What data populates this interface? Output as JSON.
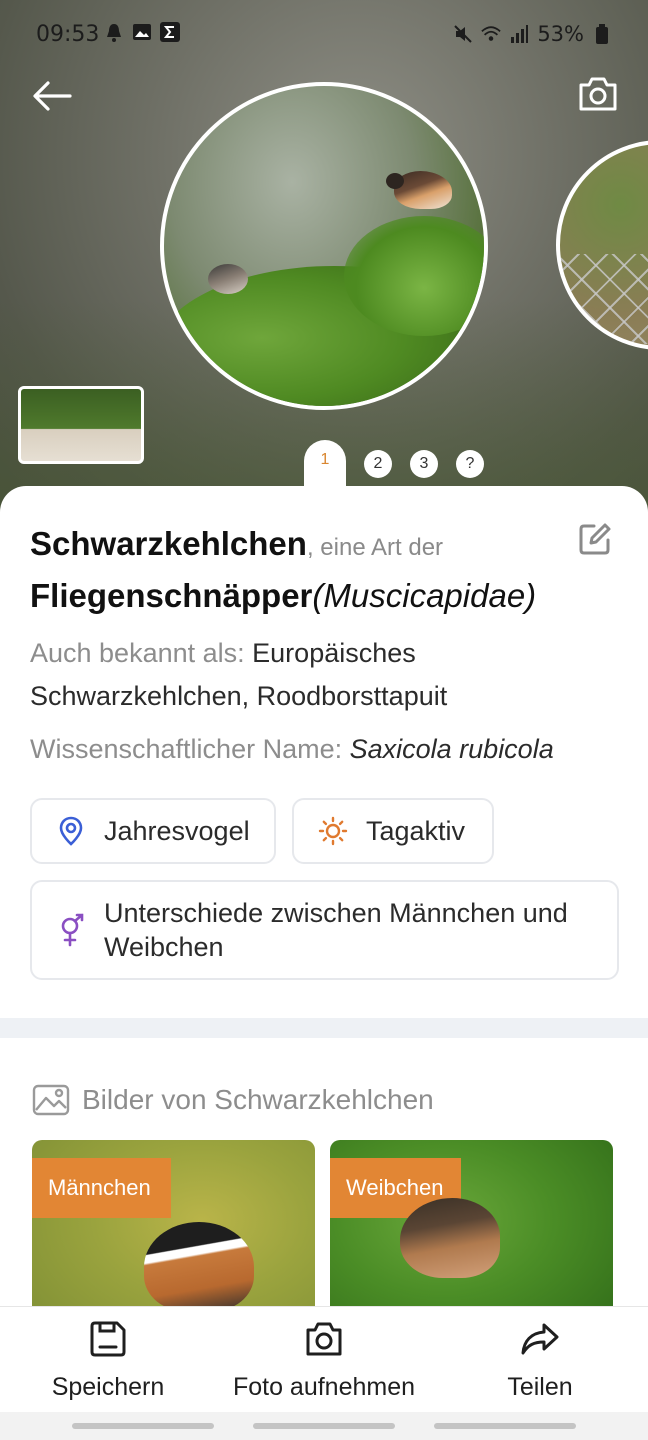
{
  "status_bar": {
    "time": "09:53",
    "battery": "53%",
    "icons": [
      "notification-icon",
      "image-icon",
      "sigma-icon",
      "mute-icon",
      "wifi-icon",
      "signal-icon",
      "battery-icon"
    ]
  },
  "hero": {
    "pages": [
      "1",
      "2",
      "3",
      "?"
    ],
    "active_page": "1"
  },
  "species": {
    "name": "Schwarzkehlchen",
    "kind_text": ", eine Art der",
    "family": "Fliegenschnäpper",
    "family_latin": "(Muscicapidae)",
    "aka_label": "Auch bekannt als: ",
    "aka_value": "Europäisches Schwarzkehlchen, Roodborsttapuit",
    "scientific_label": "Wissenschaftlicher Name: ",
    "scientific_value": "Saxicola rubicola"
  },
  "chips": {
    "year": "Jahresvogel",
    "day": "Tagaktiv",
    "sex": "Unterschiede zwischen Männchen und Weibchen"
  },
  "images": {
    "title": "Bilder von Schwarzkehlchen",
    "male_tag": "Männchen",
    "female_tag": "Weibchen"
  },
  "actions": {
    "save": "Speichern",
    "photo": "Foto aufnehmen",
    "share": "Teilen"
  },
  "colors": {
    "accent": "#e28634",
    "chip_border": "#e6e8ec",
    "location_icon": "#3b5fd6",
    "sun_icon": "#e07a2f",
    "gender_icon": "#8a4fc2"
  }
}
